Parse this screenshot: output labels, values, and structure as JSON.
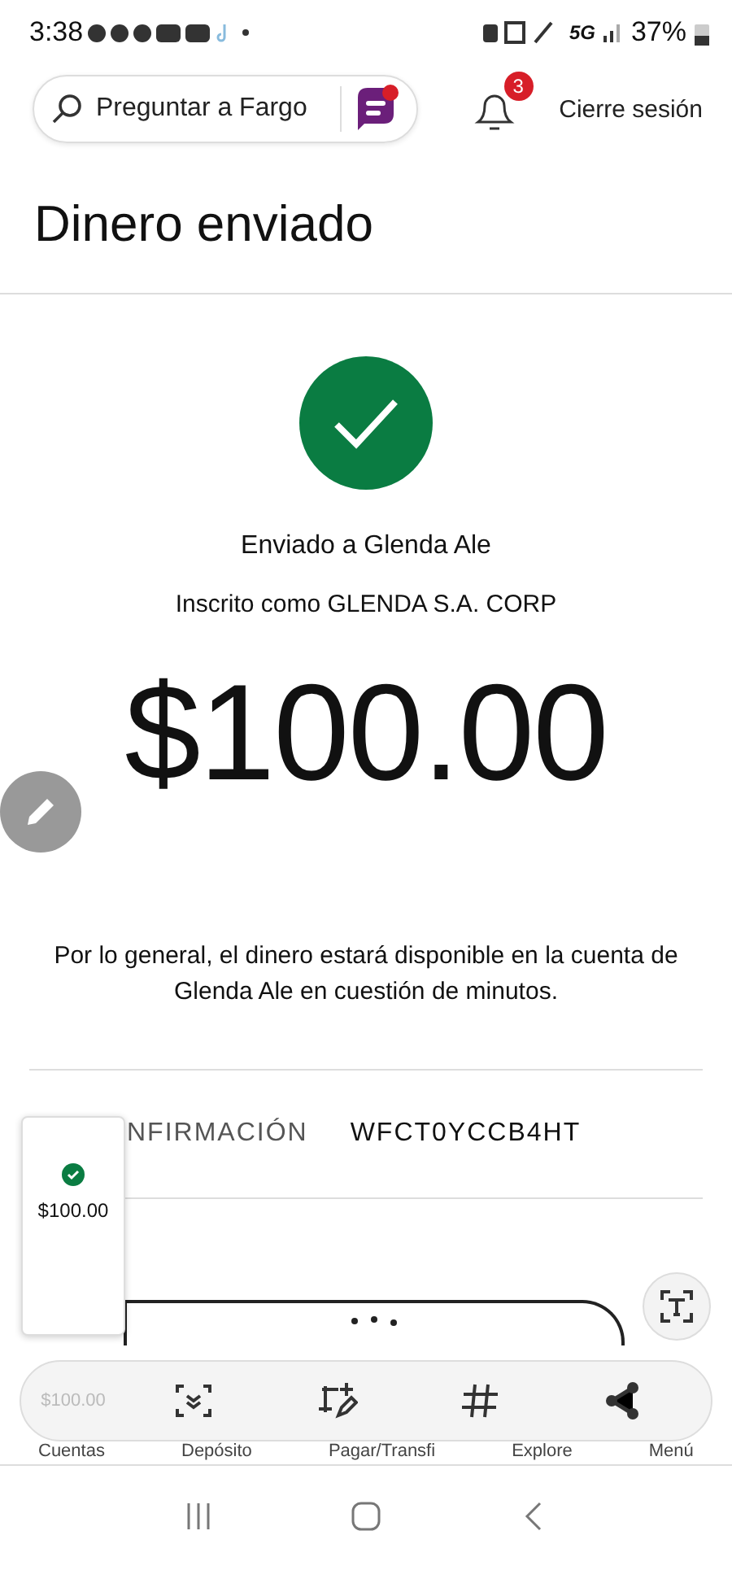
{
  "status_bar": {
    "time": "3:38",
    "battery": "37%",
    "network": "5G"
  },
  "header": {
    "search": {
      "placeholder": "Preguntar a Fargo"
    },
    "notifications": "3",
    "logout": "Cierre sesión"
  },
  "title": "Dinero enviado",
  "confirmation": {
    "recipient": "Enviado a Glenda Ale",
    "enrolled": "Inscrito como GLENDA S.A. CORP",
    "amount": "$100.00",
    "note": "Por lo general, el dinero estará disponible en la cuenta de Glenda Ale en cuestión de minutos.",
    "code_label": "NFIRMACIÓN",
    "code": "WFCT0YCCB4HT"
  },
  "screenshot_preview": {
    "amount": "$100.00"
  },
  "ghost_preview": {
    "amount": "$100.00"
  },
  "bottom_nav": [
    {
      "label": "Cuentas"
    },
    {
      "label": "Depósito"
    },
    {
      "label": "Pagar/Transfi"
    },
    {
      "label": "Explore"
    },
    {
      "label": "Menú"
    }
  ],
  "capture_toolbar": [
    {
      "kind": "scroll"
    },
    {
      "kind": "draw"
    },
    {
      "kind": "tag"
    },
    {
      "kind": "share"
    }
  ]
}
